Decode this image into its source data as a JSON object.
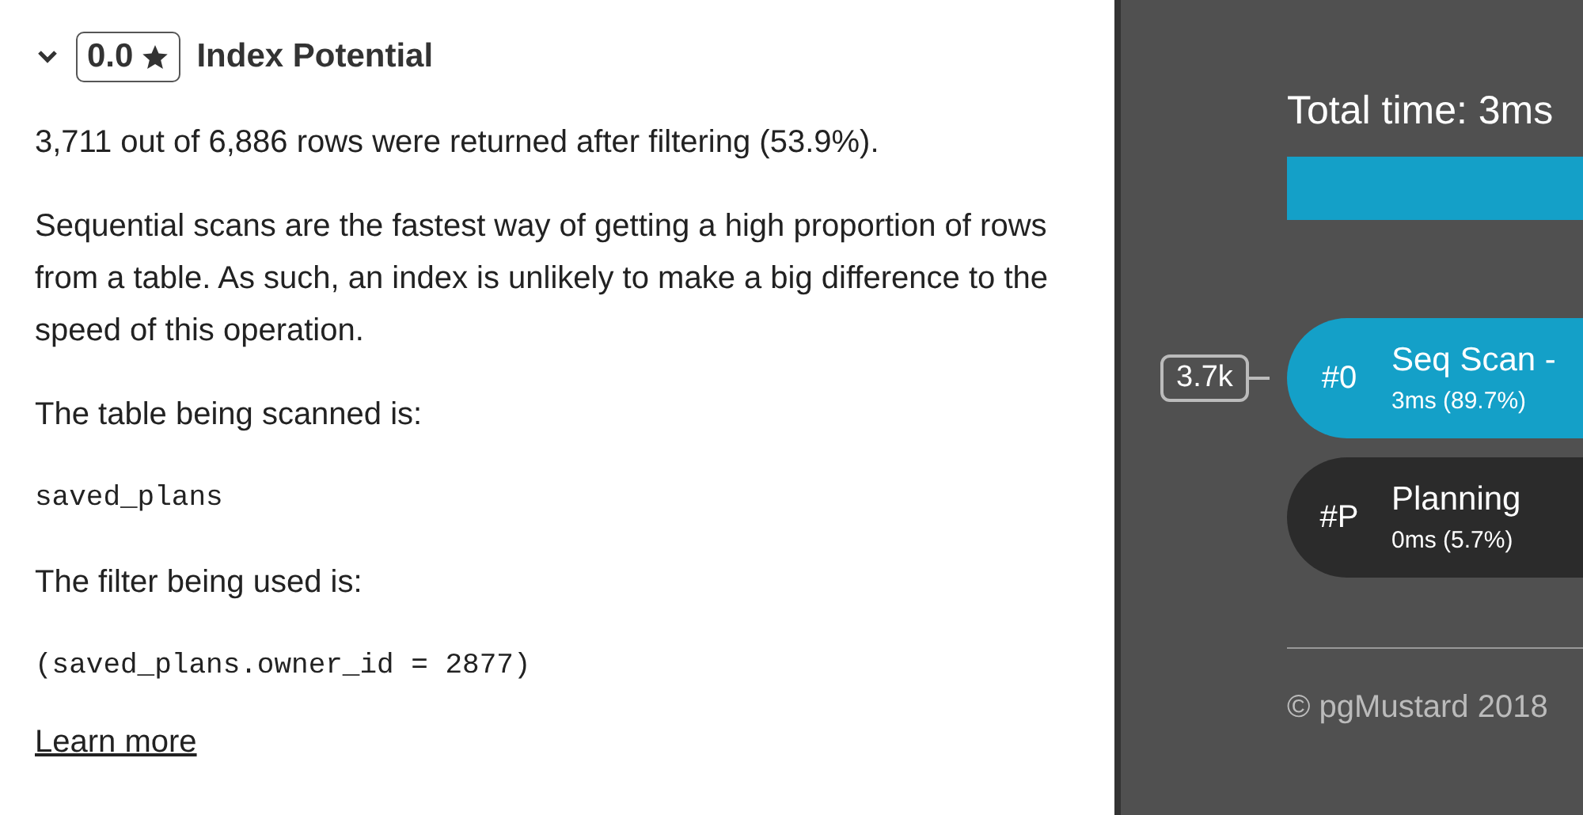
{
  "insight": {
    "expanded": true,
    "score": "0.0",
    "title": "Index Potential",
    "paragraphs": [
      {
        "kind": "text",
        "text": "3,711 out of 6,886 rows were returned after filtering (53.9%)."
      },
      {
        "kind": "text",
        "text": "Sequential scans are the fastest way of getting a high proportion of rows from a table. As such, an index is unlikely to make a big difference to the speed of this operation."
      },
      {
        "kind": "text",
        "text": "The table being scanned is:"
      },
      {
        "kind": "code",
        "text": "saved_plans"
      },
      {
        "kind": "text",
        "text": "The filter being used is:"
      },
      {
        "kind": "code",
        "text": "(saved_plans.owner_id = 2877)"
      }
    ],
    "link": "Learn more"
  },
  "plan": {
    "total_time": "Total time: 3ms",
    "nodes": [
      {
        "kind": "scan",
        "rows": "3.7k",
        "id": "#0",
        "title": "Seq Scan -",
        "timing": "3ms (89.7%)"
      },
      {
        "kind": "planning",
        "id": "#P",
        "title": "Planning",
        "timing": "0ms (5.7%)"
      }
    ],
    "footer": "© pgMustard 2018"
  }
}
